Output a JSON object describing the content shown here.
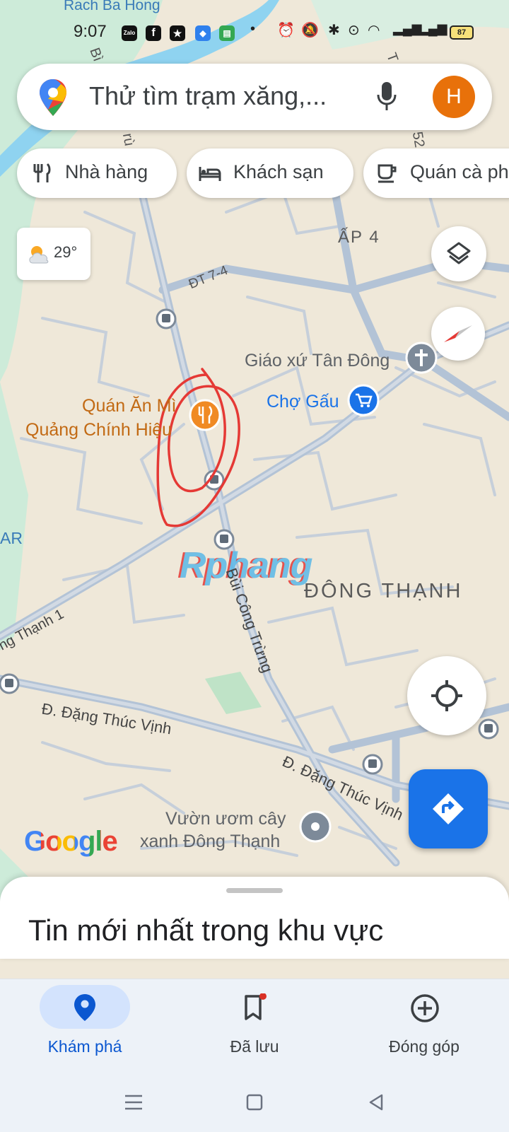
{
  "status_bar": {
    "time": "9:07",
    "apps": [
      "Zalo",
      "Facebook",
      "Star app",
      "Messaging",
      "Chat"
    ],
    "icons": [
      "dot-icon",
      "alarm-icon",
      "mute-icon",
      "bluetooth-icon",
      "location-icon",
      "wifi-icon",
      "signal-icon",
      "signal-icon"
    ],
    "battery": "87"
  },
  "search": {
    "placeholder": "Thử tìm trạm xăng,...",
    "avatar_letter": "H"
  },
  "chips": [
    {
      "label": "Nhà hàng",
      "icon": "restaurant-icon"
    },
    {
      "label": "Khách sạn",
      "icon": "hotel-icon"
    },
    {
      "label": "Quán cà phê",
      "icon": "cafe-icon"
    }
  ],
  "weather": {
    "temp": "29°",
    "icon": "partly-cloudy-icon"
  },
  "map": {
    "labels": {
      "rach_ba_hong": "Rach Ba Hong",
      "ap4": "ẤP 4",
      "dt74": "ĐT 7-4",
      "giao_xu": "Giáo xứ Tân Đông",
      "cho_gau": "Chợ Gấu",
      "quan_an_1": "Quán Ăn Mì",
      "quan_an_2": "Quảng Chính Hiệu",
      "ar": "AR",
      "dong_thanh": "ĐÔNG THẠNH",
      "bui_cong_trung": "Bùi Công Trừng",
      "thanh1": "ng Thạnh 1",
      "dang_thuc_vinh_1": "Đ. Đặng Thúc Vịnh",
      "dang_thuc_vinh_2": "Đ. Đặng Thúc Vịnh",
      "vuon_uom_1": "Vườn ươm cây",
      "vuon_uom_2": "xanh Đông Thạnh",
      "road_b": "Bì",
      "road_ru": "rù",
      "road_52": "52",
      "road_t": "T"
    },
    "watermark": "Rphang",
    "google_logo": "Google"
  },
  "bottom_sheet": {
    "title": "Tin mới nhất trong khu vực"
  },
  "bottom_nav": {
    "items": [
      {
        "label": "Khám phá",
        "icon": "explore-pin-icon",
        "active": true
      },
      {
        "label": "Đã lưu",
        "icon": "bookmark-icon",
        "active": false
      },
      {
        "label": "Đóng góp",
        "icon": "add-circle-icon",
        "active": false
      }
    ]
  },
  "colors": {
    "accent": "#1a73e8",
    "avatar": "#e8710a",
    "poi_food": "#e8710a",
    "poi_shop": "#1a73e8",
    "annotation": "#e53935"
  }
}
